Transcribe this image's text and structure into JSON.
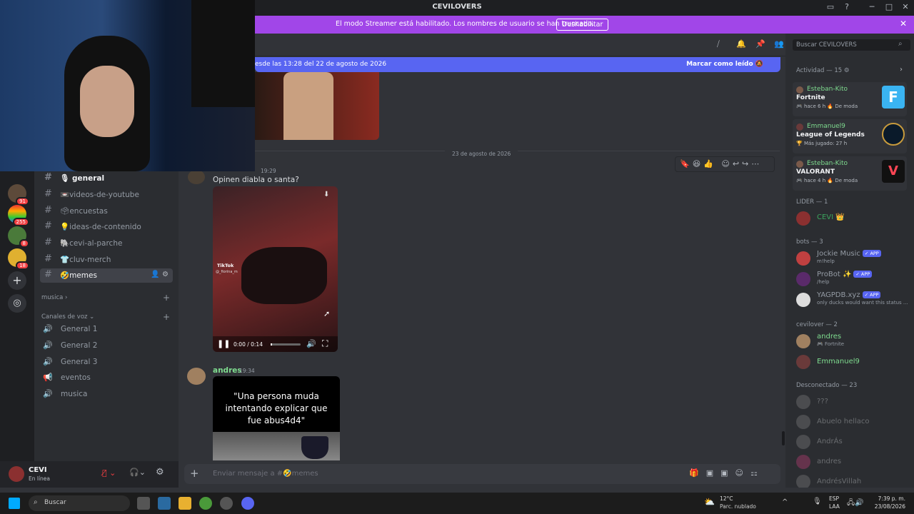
{
  "window": {
    "title": "CEVILOVERS",
    "min": "─",
    "max": "□",
    "close": "✕"
  },
  "banner": {
    "text": "El modo Streamer está habilitado. Los nombres de usuario se han truncado.",
    "button": "Deshabilitar"
  },
  "servers": [
    {
      "badge": "91"
    },
    {
      "badge": "255"
    },
    {
      "badge": "8"
    },
    {
      "badge": "18"
    }
  ],
  "channels": [
    {
      "name": "general",
      "icon": "🎙"
    },
    {
      "name": "videos-de-youtube",
      "icon": "📼"
    },
    {
      "name": "encuestas",
      "icon": "🗳"
    },
    {
      "name": "ideas-de-contenido",
      "icon": "💡"
    },
    {
      "name": "cevi-al-parche",
      "icon": "🐘"
    },
    {
      "name": "cluv-merch",
      "icon": "👕"
    },
    {
      "name": "memes",
      "icon": "🤣"
    }
  ],
  "categories": {
    "musica": "musica",
    "voz": "Canales de voz"
  },
  "voice_channels": [
    "General 1",
    "General 2",
    "General 3",
    "eventos",
    "musica"
  ],
  "user": {
    "name": "CEVI",
    "status": "En línea"
  },
  "chat": {
    "new_messages": "esde las 13:28 del 22 de agosto de 2026",
    "mark_read": "Marcar como leído",
    "date_divider": "23 de agosto de 2026",
    "msg1": {
      "time": "19:29",
      "text": "Opinen diabla o santa?",
      "video_time": "0:00 / 0:14",
      "tiktok": "TikTok",
      "handle": "@_fiorina_m"
    },
    "msg2": {
      "author": "andres",
      "time": "19:34",
      "caption": "\"Una persona muda intentando explicar que fue abus4d4\""
    },
    "composer_placeholder": "Enviar mensaje a #🤣memes"
  },
  "search": {
    "placeholder": "Buscar CEVILOVERS"
  },
  "members": {
    "activity_header": "Actividad — 15",
    "activities": [
      {
        "name": "Esteban-Kito",
        "game": "Fortnite",
        "time": "hace 6 h",
        "tag": "De moda",
        "color": "#3ab4f2"
      },
      {
        "name": "Emmanuel9",
        "game": "League of Legends",
        "time": "Más jugado: 27 h",
        "tag": "",
        "color": "#c89b3c"
      },
      {
        "name": "Esteban-Kito",
        "game": "VALORANT",
        "time": "hace 4 h",
        "tag": "De moda",
        "color": "#ff4655"
      }
    ],
    "lider_header": "LIDER — 1",
    "lider": [
      {
        "name": "CEVI 👑",
        "color": "#3ba55d"
      }
    ],
    "bots_header": "bots — 3",
    "bots": [
      {
        "name": "Jockie Music",
        "status": "m!help",
        "tag": "APP"
      },
      {
        "name": "ProBot ✨",
        "status": "/help",
        "tag": "APP"
      },
      {
        "name": "YAGPDB.xyz",
        "status": "only ducks would want this status ...",
        "tag": "APP"
      }
    ],
    "cevilover_header": "cevilover — 2",
    "cevilover": [
      {
        "name": "andres",
        "status": "Fortnite"
      },
      {
        "name": "Emmanuel9",
        "status": ""
      }
    ],
    "offline_header": "Desconectado — 23",
    "offline": [
      "???",
      "Abuelo hellaco",
      "AndrÁs",
      "andres",
      "AndrésVillah"
    ]
  },
  "taskbar": {
    "search": "Buscar",
    "weather_temp": "12°C",
    "weather_desc": "Parc. nublado",
    "lang": "ESP",
    "lang2": "LAA",
    "time": "7:39 p. m.",
    "date": "23/08/2026"
  }
}
